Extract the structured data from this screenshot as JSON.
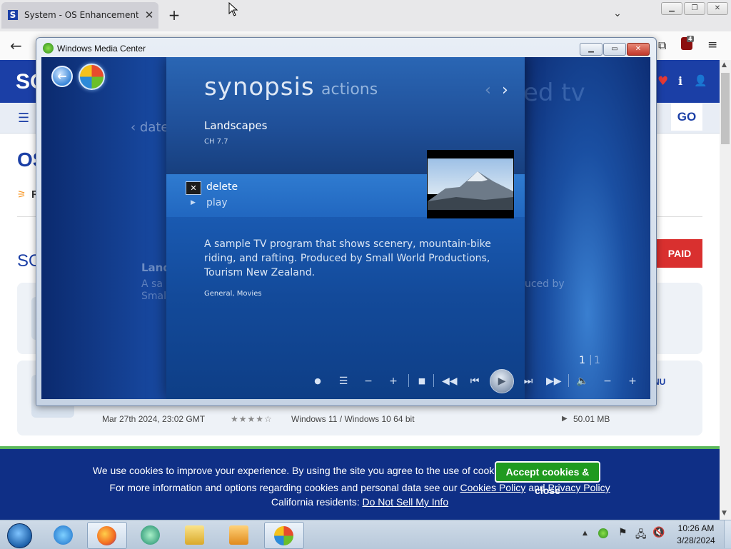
{
  "browser": {
    "tab_title": "System - OS Enhancements Do",
    "favicon_letter": "S",
    "new_tab": "+",
    "close_tab": "✕",
    "window_controls": [
      "▭",
      "❐",
      "✕"
    ],
    "extension_badge": "4"
  },
  "site": {
    "logo_text": "SO",
    "go_label": "GO",
    "page_heading": "OS",
    "rss_text": "R",
    "section_heading": "SO",
    "paid_label": "PAID",
    "menu_label": "NU",
    "row": {
      "date": "Mar 27th 2024, 23:02 GMT",
      "stars": "★★★★☆",
      "os": "Windows 11 / Windows 10 64 bit",
      "size": "50.01 MB"
    }
  },
  "cookie": {
    "line1": "We use cookies to improve your experience. By using the site you agree to the use of cookies.",
    "accept_label": "Accept cookies & close",
    "line2_prefix": "For more information and options regarding cookies and personal data see our",
    "cookies_policy": "Cookies Policy",
    "and": "and",
    "privacy_policy": "Privacy Policy",
    "line3_prefix": "California residents:",
    "do_not_sell": "Do Not Sell My Info"
  },
  "wmc": {
    "window_title": "Windows Media Center",
    "bg_recorded": "rded tv",
    "bg_date": "‹ date",
    "bg_land": "Land",
    "bg_desc1": "A sa",
    "bg_desc2": "Smal",
    "bg_desc_right": "uced by",
    "tabs": {
      "synopsis": "synopsis",
      "actions": "actions"
    },
    "nav": {
      "prev": "‹",
      "next": "›"
    },
    "program": {
      "title": "Landscapes",
      "channel": "CH 7.7",
      "description": "A sample TV program that shows scenery, mountain-bike riding, and rafting. Produced by Small World Productions, Tourism New Zealand.",
      "genre": "General, Movies"
    },
    "actions": [
      {
        "label": "delete"
      },
      {
        "label": "play"
      }
    ],
    "paging": {
      "current": "1",
      "total": "1"
    }
  },
  "taskbar": {
    "clock_time": "10:26 AM",
    "clock_date": "3/28/2024"
  }
}
